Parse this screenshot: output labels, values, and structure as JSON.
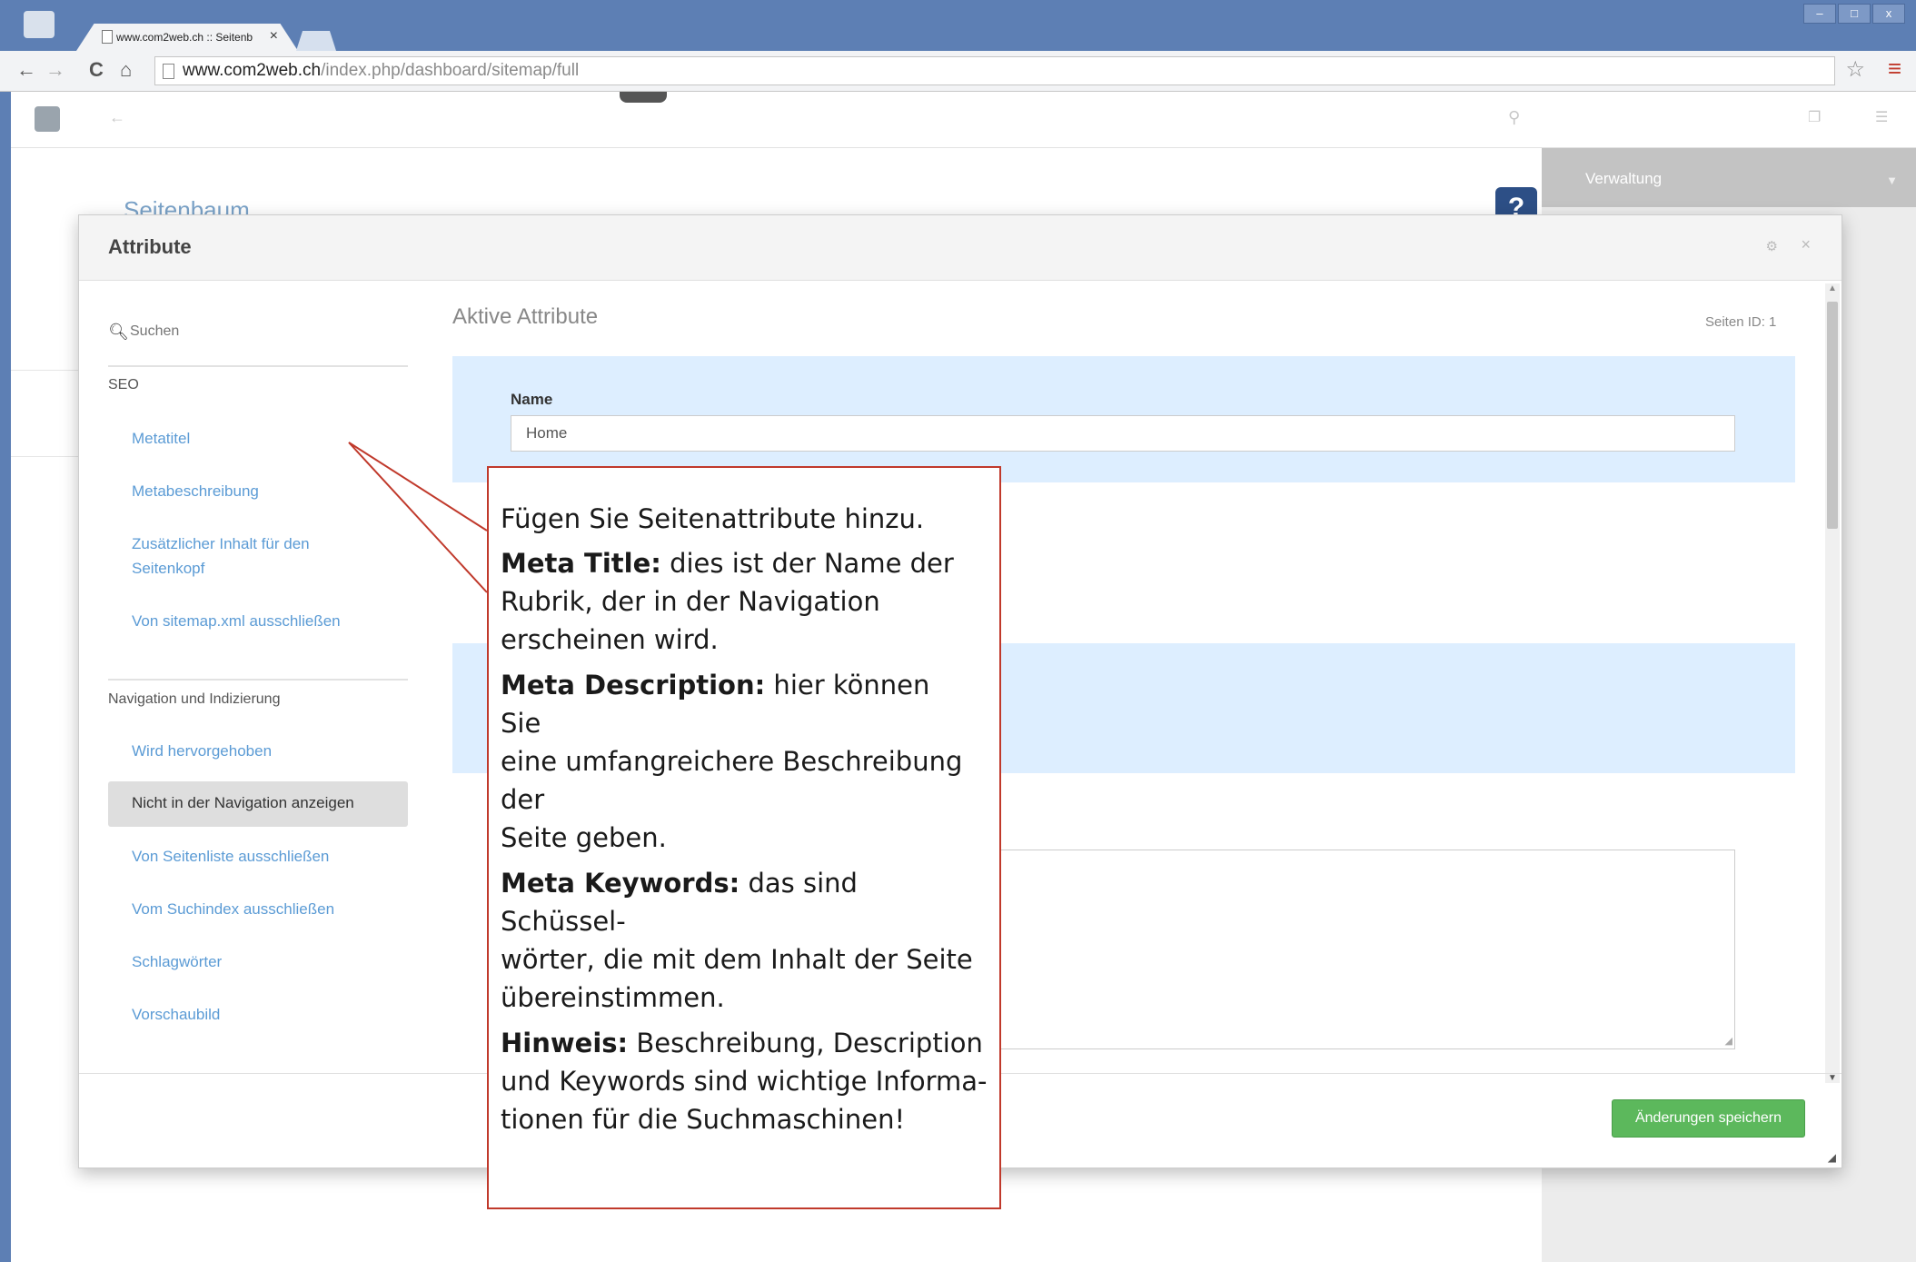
{
  "browser": {
    "tab_title": "www.com2web.ch :: Seitenb",
    "url_host": "www.com2web.ch",
    "url_path": "/index.php/dashboard/sitemap/full",
    "window_controls": [
      "–",
      "□",
      "x"
    ]
  },
  "cms": {
    "background_title": "Seitenbaum",
    "help_label": "?",
    "panel_label": "Verwaltung"
  },
  "modal": {
    "title": "Attribute",
    "search_placeholder": "Suchen",
    "groups": [
      {
        "label": "SEO",
        "items": [
          "Metatitel",
          "Metabeschreibung",
          "Zusätzlicher Inhalt für den Seitenkopf",
          "Von sitemap.xml ausschließen"
        ]
      },
      {
        "label": "Navigation und Indizierung",
        "items": [
          "Wird hervorgehoben",
          "Nicht in der Navigation anzeigen",
          "Von Seitenliste ausschließen",
          "Vom Suchindex ausschließen",
          "Schlagwörter",
          "Vorschaubild"
        ]
      }
    ],
    "selected_item": "Nicht in der Navigation anzeigen",
    "active_heading": "Aktive Attribute",
    "page_id": "Seiten ID: 1",
    "name_label": "Name",
    "name_value": "Home",
    "save_label": "Änderungen speichern",
    "save_color": "#5cb85c"
  },
  "callout": {
    "intro": "Fügen Sie Seitenattribute hinzu.",
    "meta_title_label": "Meta Title:",
    "meta_title_text_1": " dies ist der Name der",
    "meta_title_text_2": "Rubrik, der in der Navigation",
    "meta_title_text_3": "erscheinen wird.",
    "meta_desc_label": "Meta Description:",
    "meta_desc_text_1": " hier können",
    "meta_desc_text_2": "Sie",
    "meta_desc_text_3": "eine umfangreichere Beschreibung der",
    "meta_desc_text_4": "Seite geben.",
    "meta_kw_label": "Meta Keywords:",
    "meta_kw_text_1": " das sind",
    "meta_kw_text_2": "Schüssel-",
    "meta_kw_text_3": "wörter, die mit dem Inhalt der Seite",
    "meta_kw_text_4": "übereinstimmen.",
    "hint_label": "Hinweis:",
    "hint_text_1": " Beschreibung, Description",
    "hint_text_2": "und Keywords sind wichtige Informa-",
    "hint_text_3": "tionen für die Suchmaschinen!",
    "border_color": "#c0392b"
  }
}
